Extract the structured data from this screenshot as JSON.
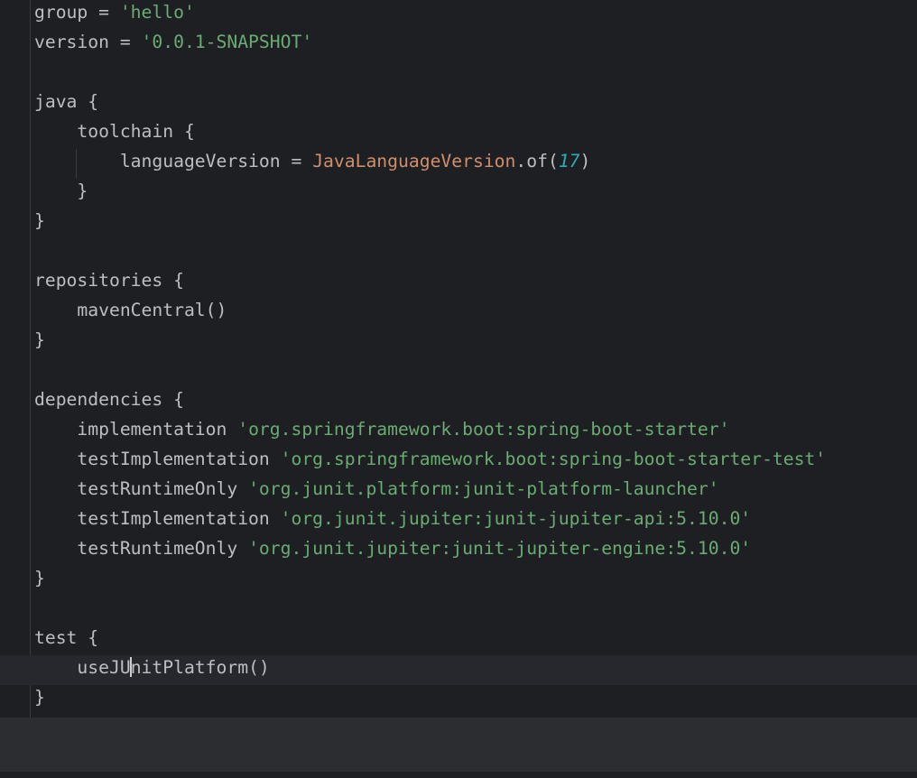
{
  "editor": {
    "lines": [
      {
        "a": "group = ",
        "b": "'hello'"
      },
      {
        "a": "version = ",
        "b": "'0.0.1-SNAPSHOT'"
      },
      {},
      {
        "a": "java {"
      },
      {
        "a": "    toolchain {"
      },
      {
        "a": "        languageVersion = ",
        "b": "JavaLanguageVersion",
        "c": ".of(",
        "d": "17",
        "e": ")"
      },
      {
        "a": "    }"
      },
      {
        "a": "}"
      },
      {},
      {
        "a": "repositories {"
      },
      {
        "a": "    mavenCentral()"
      },
      {
        "a": "}"
      },
      {},
      {
        "a": "dependencies {"
      },
      {
        "a": "    implementation ",
        "b": "'org.springframework.boot:spring-boot-starter'"
      },
      {
        "a": "    testImplementation ",
        "b": "'org.springframework.boot:spring-boot-starter-test'"
      },
      {
        "a": "    testRuntimeOnly ",
        "b": "'org.junit.platform:junit-platform-launcher'"
      },
      {
        "a": "    testImplementation ",
        "b": "'org.junit.jupiter:junit-jupiter-api:5.10.0'"
      },
      {
        "a": "    testRuntimeOnly ",
        "b": "'org.junit.jupiter:junit-jupiter-engine:5.10.0'"
      },
      {
        "a": "}"
      },
      {},
      {
        "a": "test {"
      },
      {
        "a": "    useJU",
        "b": "nitPlatform()"
      },
      {
        "a": "}"
      }
    ]
  },
  "colors": {
    "background": "#1e1f22",
    "text": "#bcbec4",
    "string": "#6aab73",
    "class": "#cf8e6d",
    "number": "#2aacb8",
    "current_line": "#26282e",
    "panel": "#2b2d30"
  }
}
